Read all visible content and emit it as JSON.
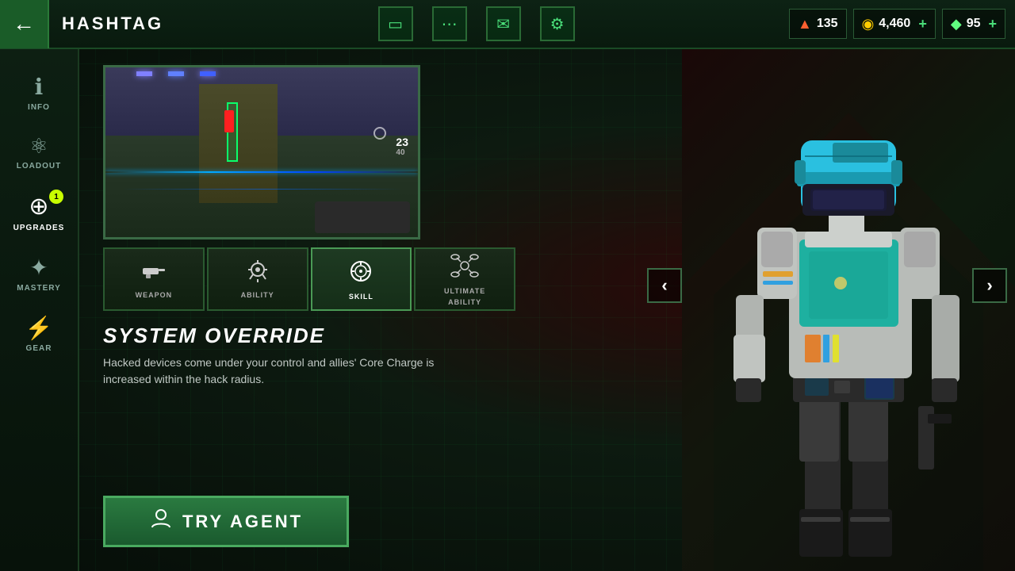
{
  "topbar": {
    "back_label": "←",
    "title": "HASHTAG",
    "icons": [
      "controller",
      "chat",
      "mail",
      "settings"
    ],
    "currencies": [
      {
        "icon": "▲",
        "value": "135",
        "color": "#ff6030",
        "has_plus": false
      },
      {
        "icon": "◉",
        "value": "4,460",
        "color": "#ffcc00",
        "has_plus": true
      },
      {
        "icon": "◆",
        "value": "95",
        "color": "#60ff80",
        "has_plus": true
      }
    ]
  },
  "sidebar": {
    "items": [
      {
        "id": "info",
        "label": "INFO",
        "icon": "ℹ",
        "active": false
      },
      {
        "id": "loadout",
        "label": "LOADOUT",
        "icon": "⚛",
        "active": false
      },
      {
        "id": "upgrades",
        "label": "UPGRADES",
        "icon": "⊕",
        "active": true,
        "badge": "1"
      },
      {
        "id": "mastery",
        "label": "MASTERY",
        "icon": "★",
        "active": false
      },
      {
        "id": "gear",
        "label": "GEAR",
        "icon": "⚡",
        "active": false
      }
    ]
  },
  "preview": {
    "ammo_current": "23",
    "ammo_total": "40"
  },
  "ability_tabs": [
    {
      "id": "weapon",
      "label": "WEAPON",
      "active": false
    },
    {
      "id": "ability",
      "label": "ABILITY",
      "active": false
    },
    {
      "id": "skill",
      "label": "SKILL",
      "active": false
    },
    {
      "id": "ultimate",
      "label": "ULTIMATE\nABILITY",
      "label_line1": "ULTIMATE",
      "label_line2": "ABILITY",
      "active": true
    }
  ],
  "ability": {
    "title": "SYSTEM OVERRIDE",
    "description": "Hacked devices come under your control and allies' Core Charge is increased within the hack radius."
  },
  "try_agent_btn": {
    "label": "TRY AGENT",
    "icon": "👤"
  },
  "nav": {
    "left": "‹",
    "right": "›"
  }
}
